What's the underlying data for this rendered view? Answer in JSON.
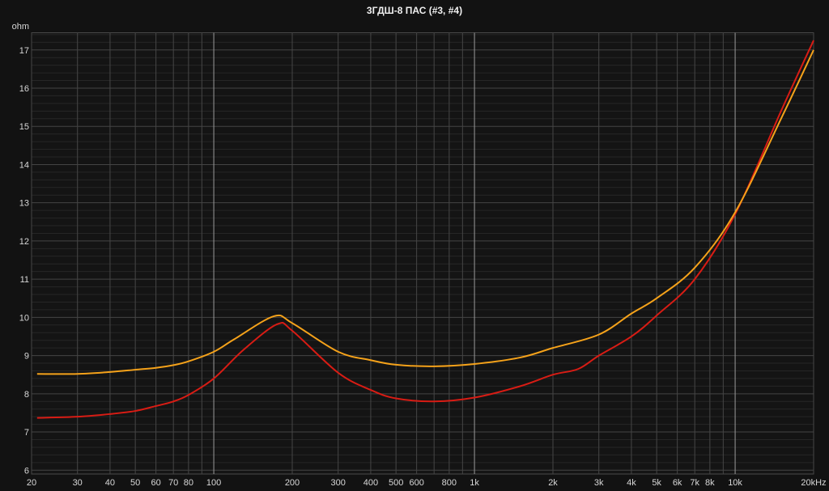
{
  "chart_data": {
    "type": "line",
    "title": "3ГДШ-8 ПАС (#3, #4)",
    "ylabel": "ohm",
    "xlabel": "",
    "xscale": "log",
    "xlim": [
      20,
      20000
    ],
    "ylim": [
      5.9,
      17.45
    ],
    "grid": true,
    "y_ticks": [
      6,
      7,
      8,
      9,
      10,
      11,
      12,
      13,
      14,
      15,
      16,
      17
    ],
    "x_ticks": [
      {
        "v": 20,
        "label": "20"
      },
      {
        "v": 30,
        "label": "30"
      },
      {
        "v": 40,
        "label": "40"
      },
      {
        "v": 50,
        "label": "50"
      },
      {
        "v": 60,
        "label": "60"
      },
      {
        "v": 70,
        "label": "70"
      },
      {
        "v": 80,
        "label": "80"
      },
      {
        "v": 100,
        "label": "100"
      },
      {
        "v": 200,
        "label": "200"
      },
      {
        "v": 300,
        "label": "300"
      },
      {
        "v": 400,
        "label": "400"
      },
      {
        "v": 500,
        "label": "500"
      },
      {
        "v": 600,
        "label": "600"
      },
      {
        "v": 800,
        "label": "800"
      },
      {
        "v": 1000,
        "label": "1k"
      },
      {
        "v": 2000,
        "label": "2k"
      },
      {
        "v": 3000,
        "label": "3k"
      },
      {
        "v": 4000,
        "label": "4k"
      },
      {
        "v": 5000,
        "label": "5k"
      },
      {
        "v": 6000,
        "label": "6k"
      },
      {
        "v": 7000,
        "label": "7k"
      },
      {
        "v": 8000,
        "label": "8k"
      },
      {
        "v": 10000,
        "label": "10k"
      },
      {
        "v": 20000,
        "label": "20kHz"
      }
    ],
    "series": [
      {
        "name": "#3",
        "color": "#d81c14",
        "x": [
          21,
          30,
          40,
          50,
          60,
          70,
          80,
          100,
          130,
          175,
          200,
          300,
          400,
          500,
          700,
          1000,
          1500,
          2000,
          2500,
          3000,
          4000,
          5000,
          7000,
          10000,
          15000,
          20000
        ],
        "y": [
          7.37,
          7.4,
          7.47,
          7.55,
          7.68,
          7.8,
          7.97,
          8.4,
          9.15,
          9.82,
          9.65,
          8.55,
          8.1,
          7.88,
          7.8,
          7.9,
          8.2,
          8.5,
          8.65,
          9.0,
          9.5,
          10.05,
          11.0,
          12.7,
          15.4,
          17.25
        ]
      },
      {
        "name": "#4",
        "color": "#f5a21a",
        "x": [
          21,
          30,
          40,
          50,
          60,
          70,
          80,
          100,
          120,
          170,
          200,
          300,
          400,
          500,
          700,
          1000,
          1500,
          2000,
          3000,
          4000,
          5000,
          7000,
          10000,
          15000,
          20000
        ],
        "y": [
          8.52,
          8.52,
          8.57,
          8.63,
          8.68,
          8.75,
          8.85,
          9.1,
          9.43,
          10.03,
          9.85,
          9.1,
          8.88,
          8.76,
          8.72,
          8.78,
          8.95,
          9.2,
          9.55,
          10.1,
          10.5,
          11.3,
          12.75,
          15.2,
          17.0
        ]
      }
    ]
  }
}
